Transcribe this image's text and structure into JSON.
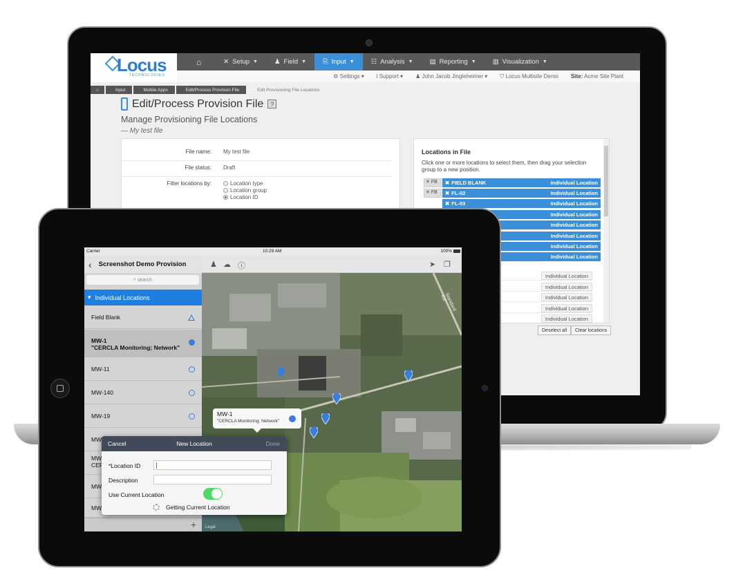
{
  "web": {
    "logo": {
      "name": "Locus",
      "sub": "TECHNOLOGIES"
    },
    "nav": [
      {
        "label": "Setup",
        "icon": "tools-icon"
      },
      {
        "label": "Field",
        "icon": "person-icon"
      },
      {
        "label": "Input",
        "icon": "input-icon",
        "active": true
      },
      {
        "label": "Analysis",
        "icon": "table-icon"
      },
      {
        "label": "Reporting",
        "icon": "document-icon"
      },
      {
        "label": "Visualization",
        "icon": "chart-icon"
      }
    ],
    "subnav": {
      "settings": "Settings",
      "support": "Support",
      "user": "John Jacob Jingleheimer",
      "org": "Locus Multisite Demo",
      "site_label": "Site:",
      "site": "Acme Site Plant"
    },
    "breadcrumb": [
      "Input",
      "Mobile Apps",
      "Edit/Process Provision File",
      "Edit Provisioning File Locations"
    ],
    "title": "Edit/Process Provision File",
    "help": "?",
    "subtitle": "Manage Provisioning File Locations",
    "file_tag": "— My test file",
    "form": {
      "file_name_label": "File name:",
      "file_name": "My test file",
      "file_status_label": "File status:",
      "file_status": "Draft",
      "filter_label": "Filter locations by:",
      "filter_options": [
        "Location type",
        "Location group",
        "Location ID"
      ],
      "filter_selected": "Location ID"
    },
    "locations": {
      "title": "Locations in File",
      "help": "Click one or more locations to select them, then drag your selection group to a new position.",
      "group_tag": "FB",
      "selected": [
        {
          "name": "FIELD BLANK",
          "type": "Individual Location"
        },
        {
          "name": "FL-02",
          "type": "Individual Location"
        },
        {
          "name": "FL-03",
          "type": "Individual Location"
        },
        {
          "name": "",
          "type": "Individual Location"
        },
        {
          "name": "",
          "type": "Individual Location"
        },
        {
          "name": "",
          "type": "Individual Location"
        },
        {
          "name": "",
          "type": "Individual Location"
        },
        {
          "name": "",
          "type": "Individual Location"
        }
      ],
      "plain": [
        "Individual Location",
        "Individual Location",
        "Individual Location",
        "Individual Location",
        "Individual Location"
      ],
      "deselect": "Deselect all",
      "clear": "Clear locations"
    }
  },
  "tablet": {
    "status": {
      "carrier": "Carrier",
      "time": "10:29 AM",
      "battery": "100%"
    },
    "sidebar": {
      "title": "Screenshot Demo Provision",
      "search": "search",
      "group": "Individual Locations",
      "items": [
        {
          "name": "Field Blank",
          "sub": "",
          "icon": "triangle"
        },
        {
          "name": "MW-1",
          "sub": "\"CERCLA Monitoring; Network\"",
          "icon": "filled-circle"
        },
        {
          "name": "MW-11",
          "sub": "",
          "icon": "circle"
        },
        {
          "name": "MW-140",
          "sub": "",
          "icon": "circle"
        },
        {
          "name": "MW-19",
          "sub": "",
          "icon": "circle"
        },
        {
          "name": "MW-1b",
          "sub": "",
          "icon": "triangle"
        },
        {
          "name": "MW",
          "sub": "CER",
          "icon": ""
        },
        {
          "name": "MW",
          "sub": "",
          "icon": ""
        },
        {
          "name": "MW",
          "sub": "",
          "icon": ""
        }
      ],
      "add": "+"
    },
    "callout": {
      "title": "MW-1",
      "sub": "\"CERCLA Monitoring; Network\""
    },
    "map_labels": {
      "road": "Standard Rd",
      "credit": "Legal"
    },
    "modal": {
      "cancel": "Cancel",
      "title": "New Location",
      "done": "Done",
      "location_id_label": "*Location ID",
      "location_id": "",
      "description_label": "Description",
      "description": "",
      "use_current_label": "Use Current Location",
      "use_current": true,
      "getting": "Getting Current Location"
    }
  }
}
